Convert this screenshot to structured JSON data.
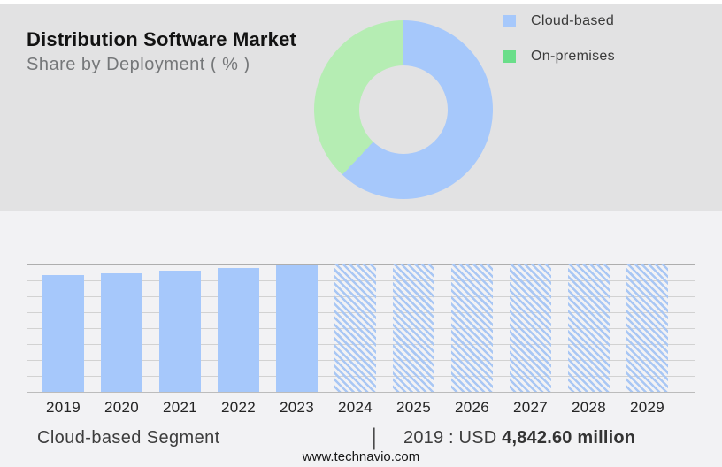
{
  "header": {
    "title": "Distribution Software Market",
    "subtitle": "Share by Deployment ( % )"
  },
  "colors": {
    "bar_blue": "#a6c8fb",
    "donut_blue": "#a6c8fb",
    "donut_green": "#b5edb3",
    "legend_green": "#6ade8a",
    "top_panel_bg": "#e2e2e3",
    "bottom_panel_bg": "#f2f2f4"
  },
  "legend": {
    "items": [
      {
        "label": "Cloud-based",
        "swatch_color": "#a6c8fb"
      },
      {
        "label": "On-premises",
        "swatch_color": "#6ade8a"
      }
    ]
  },
  "chart_data": [
    {
      "type": "pie",
      "subtype": "donut",
      "title": "Distribution Software Market",
      "subtitle": "Share by Deployment ( % )",
      "unit": "%",
      "legend_position": "right",
      "segments": [
        {
          "label": "Cloud-based",
          "value": 62,
          "color": "#a6c8fb"
        },
        {
          "label": "On-premises",
          "value": 38,
          "color": "#b5edb3"
        }
      ]
    },
    {
      "type": "bar",
      "categories": [
        "2019",
        "2020",
        "2021",
        "2022",
        "2023",
        "2024",
        "2025",
        "2026",
        "2027",
        "2028",
        "2029"
      ],
      "relative_heights_pct_of_max": [
        92,
        93,
        95,
        97,
        99,
        100,
        100,
        100,
        100,
        100,
        100
      ],
      "forecast_categories": [
        "2024",
        "2025",
        "2026",
        "2027",
        "2028",
        "2029"
      ],
      "historical_style": "solid",
      "forecast_style": "hatched",
      "bar_color": "#a6c8fb",
      "known_values": {
        "2019": "USD 4,842.60 million"
      },
      "gridlines": 9,
      "y_axis_tick_labels": "none",
      "grid_on": true
    }
  ],
  "footer": {
    "segment_label": "Cloud-based Segment",
    "divider": "|",
    "stat_prefix": "2019 : USD ",
    "stat_value": "4,842.60 million",
    "website": "www.technavio.com"
  }
}
